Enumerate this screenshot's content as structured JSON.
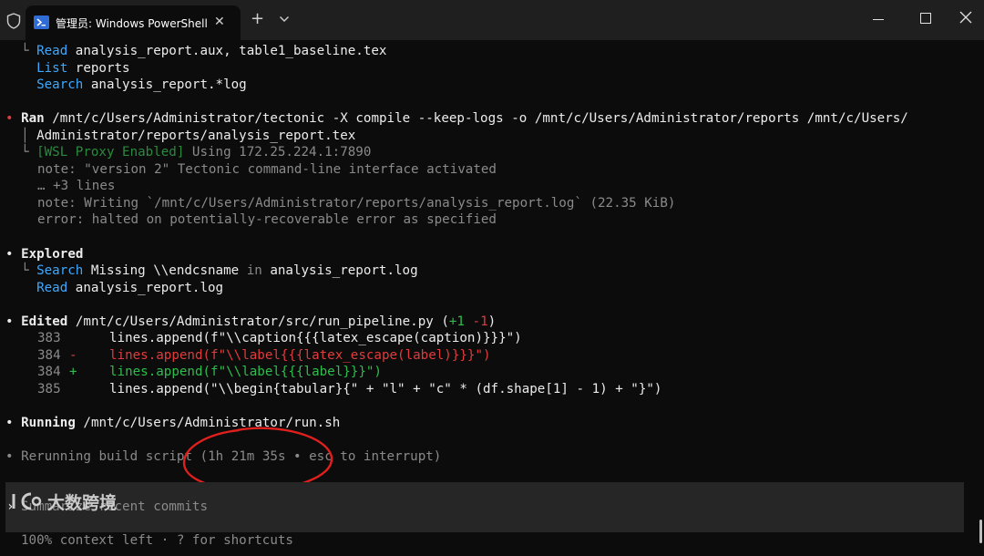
{
  "window": {
    "tab_title": "管理员: Windows PowerShell",
    "tab_close": "✕",
    "new_tab": "+"
  },
  "terminal": {
    "l1": {
      "tree": "└ ",
      "verb": "Read",
      "rest": " analysis_report.aux, table1_baseline.tex"
    },
    "l2": {
      "indent": "  ",
      "verb": "List",
      "rest": " reports"
    },
    "l3": {
      "indent": "  ",
      "verb": "Search",
      "rest": " analysis_report.*log"
    },
    "l4": {
      "bullet": "•",
      "verb": "Ran",
      "rest": " /mnt/c/Users/Administrator/tectonic -X compile --keep-logs -o /mnt/c/Users/Administrator/reports /mnt/c/Users/"
    },
    "l5": {
      "tree": "│ ",
      "rest": "Administrator/reports/analysis_report.tex"
    },
    "l6": {
      "tree": "└ ",
      "proxy": "[WSL Proxy Enabled]",
      "rest": " Using 172.25.224.1:7890"
    },
    "l7": {
      "rest": "note: \"version 2\" Tectonic command-line interface activated"
    },
    "l8": {
      "rest": "… +3 lines"
    },
    "l9": {
      "rest": "note: Writing `/mnt/c/Users/Administrator/reports/analysis_report.log` (22.35 KiB)"
    },
    "l10": {
      "rest": "error: halted on potentially-recoverable error as specified"
    },
    "l11": {
      "bullet": "•",
      "verb": "Explored"
    },
    "l12": {
      "tree": "└ ",
      "verb": "Search",
      "rest1": " Missing \\\\endcsname ",
      "kw": "in",
      "rest2": " analysis_report.log"
    },
    "l13": {
      "indent": "  ",
      "verb": "Read",
      "rest": " analysis_report.log"
    },
    "l14": {
      "bullet": "•",
      "verb": "Edited",
      "path": " /mnt/c/Users/Administrator/src/run_pipeline.py ",
      "open": "(",
      "plus": "+1",
      "minus": "-1",
      "close": ")"
    },
    "l15": {
      "num": "383",
      "code": "lines.append(f\"\\\\caption{{{latex_escape(caption)}}}\")"
    },
    "l16": {
      "num": "384",
      "sign": "-",
      "code": "lines.append(f\"\\\\label{{{latex_escape(label)}}}\")"
    },
    "l17": {
      "num": "384",
      "sign": "+",
      "code": "lines.append(f\"\\\\label{{{label}}}\")"
    },
    "l18": {
      "num": "385",
      "code": "lines.append(\"\\\\begin{tabular}{\" + \"l\" + \"c\" * (df.shape[1] - 1) + \"}\")"
    },
    "l19": {
      "bullet": "•",
      "verb": "Running",
      "rest": " /mnt/c/Users/Administrator/run.sh"
    },
    "l20": {
      "bullet": "•",
      "rest": " Rerunning build script (1h 21m 35s • esc to interrupt)"
    }
  },
  "input": {
    "prompt": "›",
    "placeholder": "Summarize recent commits"
  },
  "footer": {
    "text": "100% context left · ? for shortcuts"
  },
  "watermark": {
    "text": "大数跨境"
  },
  "colors": {
    "background": "#0c0c0c",
    "titlebar": "#1f1f1f",
    "accent_blue": "#3ea8ff",
    "diff_red": "#e23b3b",
    "diff_green": "#2ebd4e",
    "annotation": "#e0201c"
  },
  "icons": {
    "shield": "shield-icon",
    "powershell": "powershell-icon",
    "close": "close-icon",
    "dropdown": "chevron-down-icon",
    "minimize": "minimize-icon",
    "maximize": "maximize-icon",
    "window_close": "window-close-icon"
  }
}
